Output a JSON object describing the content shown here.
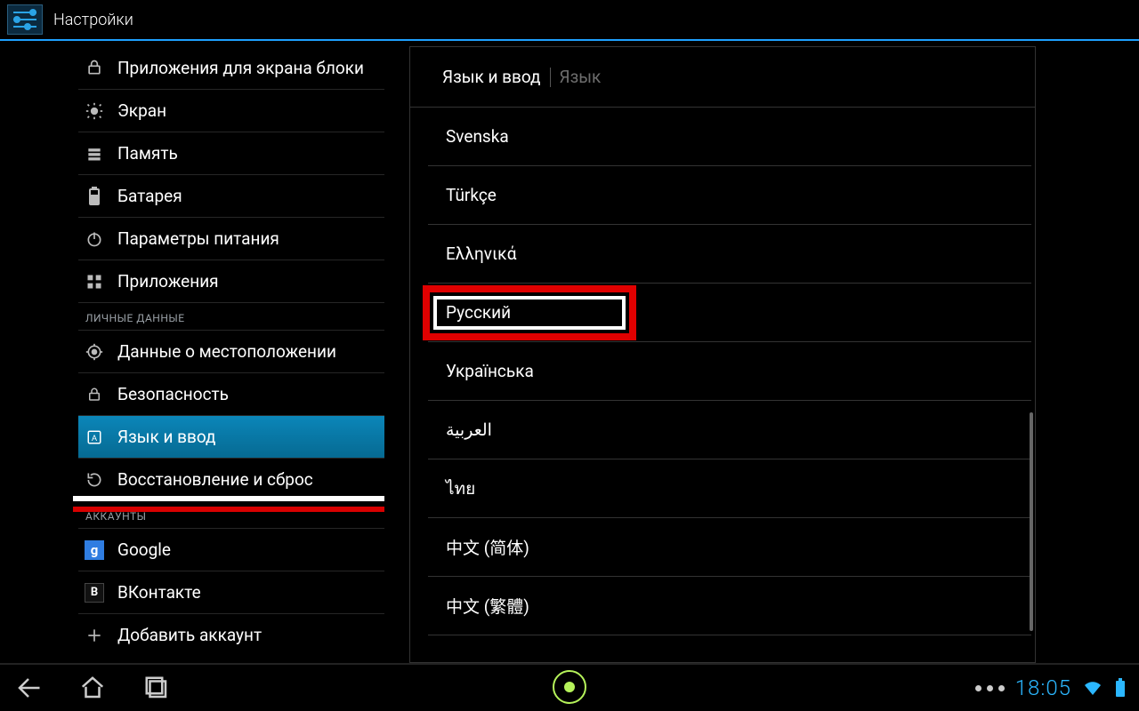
{
  "appbar": {
    "title": "Настройки"
  },
  "sidebar": {
    "items": [
      {
        "label": "Приложения для экрана блоки",
        "icon": "lock-icon"
      },
      {
        "label": "Экран",
        "icon": "display-icon"
      },
      {
        "label": "Память",
        "icon": "storage-icon"
      },
      {
        "label": "Батарея",
        "icon": "battery-icon"
      },
      {
        "label": "Параметры питания",
        "icon": "power-icon"
      },
      {
        "label": "Приложения",
        "icon": "apps-icon"
      }
    ],
    "section_personal": "ЛИЧНЫЕ ДАННЫЕ",
    "personal": [
      {
        "label": "Данные о местоположении",
        "icon": "location-icon"
      },
      {
        "label": "Безопасность",
        "icon": "security-icon"
      },
      {
        "label": "Язык и ввод",
        "icon": "language-icon",
        "selected": true
      },
      {
        "label": "Восстановление и сброс",
        "icon": "backup-icon"
      }
    ],
    "section_accounts": "АККАУНТЫ",
    "accounts": [
      {
        "label": "Google",
        "icon": "google-icon"
      },
      {
        "label": "ВКонтакте",
        "icon": "vk-icon"
      },
      {
        "label": "Добавить аккаунт",
        "icon": "plus-icon"
      }
    ]
  },
  "breadcrumb": {
    "a": "Язык и ввод",
    "b": "Язык"
  },
  "languages": [
    {
      "label": "Svenska"
    },
    {
      "label": "Türkçe"
    },
    {
      "label": "Ελληνικά"
    },
    {
      "label": "Русский",
      "highlight": true
    },
    {
      "label": "Українська"
    },
    {
      "label": "العربية"
    },
    {
      "label": "ไทย"
    },
    {
      "label": "中文 (简体)"
    },
    {
      "label": "中文 (繁體)"
    }
  ],
  "statusbar": {
    "time": "18:05"
  }
}
